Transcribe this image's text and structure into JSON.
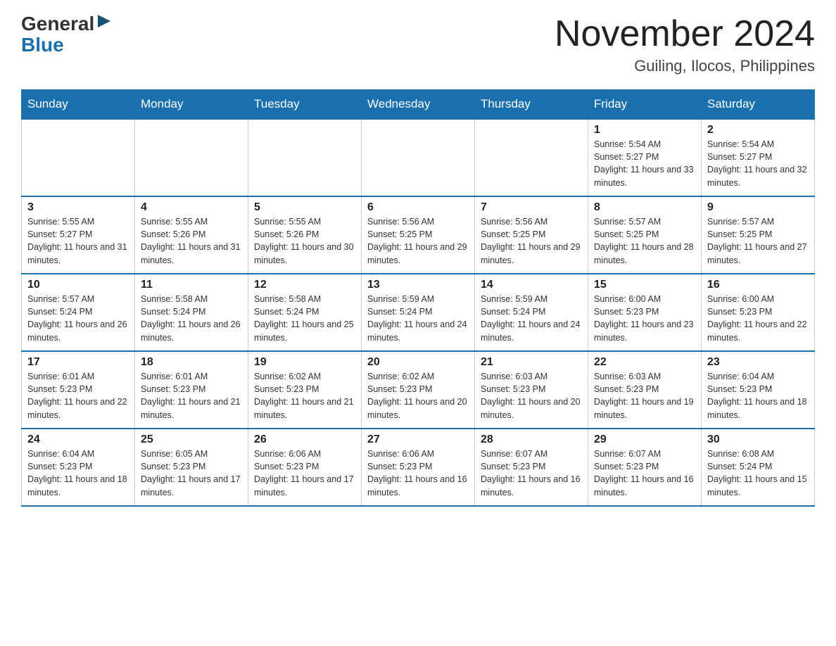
{
  "logo": {
    "general": "General",
    "blue": "Blue",
    "arrow": "▶"
  },
  "header": {
    "title": "November 2024",
    "subtitle": "Guiling, Ilocos, Philippines"
  },
  "weekdays": [
    "Sunday",
    "Monday",
    "Tuesday",
    "Wednesday",
    "Thursday",
    "Friday",
    "Saturday"
  ],
  "weeks": [
    [
      {
        "day": "",
        "info": ""
      },
      {
        "day": "",
        "info": ""
      },
      {
        "day": "",
        "info": ""
      },
      {
        "day": "",
        "info": ""
      },
      {
        "day": "",
        "info": ""
      },
      {
        "day": "1",
        "info": "Sunrise: 5:54 AM\nSunset: 5:27 PM\nDaylight: 11 hours and 33 minutes."
      },
      {
        "day": "2",
        "info": "Sunrise: 5:54 AM\nSunset: 5:27 PM\nDaylight: 11 hours and 32 minutes."
      }
    ],
    [
      {
        "day": "3",
        "info": "Sunrise: 5:55 AM\nSunset: 5:27 PM\nDaylight: 11 hours and 31 minutes."
      },
      {
        "day": "4",
        "info": "Sunrise: 5:55 AM\nSunset: 5:26 PM\nDaylight: 11 hours and 31 minutes."
      },
      {
        "day": "5",
        "info": "Sunrise: 5:55 AM\nSunset: 5:26 PM\nDaylight: 11 hours and 30 minutes."
      },
      {
        "day": "6",
        "info": "Sunrise: 5:56 AM\nSunset: 5:25 PM\nDaylight: 11 hours and 29 minutes."
      },
      {
        "day": "7",
        "info": "Sunrise: 5:56 AM\nSunset: 5:25 PM\nDaylight: 11 hours and 29 minutes."
      },
      {
        "day": "8",
        "info": "Sunrise: 5:57 AM\nSunset: 5:25 PM\nDaylight: 11 hours and 28 minutes."
      },
      {
        "day": "9",
        "info": "Sunrise: 5:57 AM\nSunset: 5:25 PM\nDaylight: 11 hours and 27 minutes."
      }
    ],
    [
      {
        "day": "10",
        "info": "Sunrise: 5:57 AM\nSunset: 5:24 PM\nDaylight: 11 hours and 26 minutes."
      },
      {
        "day": "11",
        "info": "Sunrise: 5:58 AM\nSunset: 5:24 PM\nDaylight: 11 hours and 26 minutes."
      },
      {
        "day": "12",
        "info": "Sunrise: 5:58 AM\nSunset: 5:24 PM\nDaylight: 11 hours and 25 minutes."
      },
      {
        "day": "13",
        "info": "Sunrise: 5:59 AM\nSunset: 5:24 PM\nDaylight: 11 hours and 24 minutes."
      },
      {
        "day": "14",
        "info": "Sunrise: 5:59 AM\nSunset: 5:24 PM\nDaylight: 11 hours and 24 minutes."
      },
      {
        "day": "15",
        "info": "Sunrise: 6:00 AM\nSunset: 5:23 PM\nDaylight: 11 hours and 23 minutes."
      },
      {
        "day": "16",
        "info": "Sunrise: 6:00 AM\nSunset: 5:23 PM\nDaylight: 11 hours and 22 minutes."
      }
    ],
    [
      {
        "day": "17",
        "info": "Sunrise: 6:01 AM\nSunset: 5:23 PM\nDaylight: 11 hours and 22 minutes."
      },
      {
        "day": "18",
        "info": "Sunrise: 6:01 AM\nSunset: 5:23 PM\nDaylight: 11 hours and 21 minutes."
      },
      {
        "day": "19",
        "info": "Sunrise: 6:02 AM\nSunset: 5:23 PM\nDaylight: 11 hours and 21 minutes."
      },
      {
        "day": "20",
        "info": "Sunrise: 6:02 AM\nSunset: 5:23 PM\nDaylight: 11 hours and 20 minutes."
      },
      {
        "day": "21",
        "info": "Sunrise: 6:03 AM\nSunset: 5:23 PM\nDaylight: 11 hours and 20 minutes."
      },
      {
        "day": "22",
        "info": "Sunrise: 6:03 AM\nSunset: 5:23 PM\nDaylight: 11 hours and 19 minutes."
      },
      {
        "day": "23",
        "info": "Sunrise: 6:04 AM\nSunset: 5:23 PM\nDaylight: 11 hours and 18 minutes."
      }
    ],
    [
      {
        "day": "24",
        "info": "Sunrise: 6:04 AM\nSunset: 5:23 PM\nDaylight: 11 hours and 18 minutes."
      },
      {
        "day": "25",
        "info": "Sunrise: 6:05 AM\nSunset: 5:23 PM\nDaylight: 11 hours and 17 minutes."
      },
      {
        "day": "26",
        "info": "Sunrise: 6:06 AM\nSunset: 5:23 PM\nDaylight: 11 hours and 17 minutes."
      },
      {
        "day": "27",
        "info": "Sunrise: 6:06 AM\nSunset: 5:23 PM\nDaylight: 11 hours and 16 minutes."
      },
      {
        "day": "28",
        "info": "Sunrise: 6:07 AM\nSunset: 5:23 PM\nDaylight: 11 hours and 16 minutes."
      },
      {
        "day": "29",
        "info": "Sunrise: 6:07 AM\nSunset: 5:23 PM\nDaylight: 11 hours and 16 minutes."
      },
      {
        "day": "30",
        "info": "Sunrise: 6:08 AM\nSunset: 5:24 PM\nDaylight: 11 hours and 15 minutes."
      }
    ]
  ]
}
